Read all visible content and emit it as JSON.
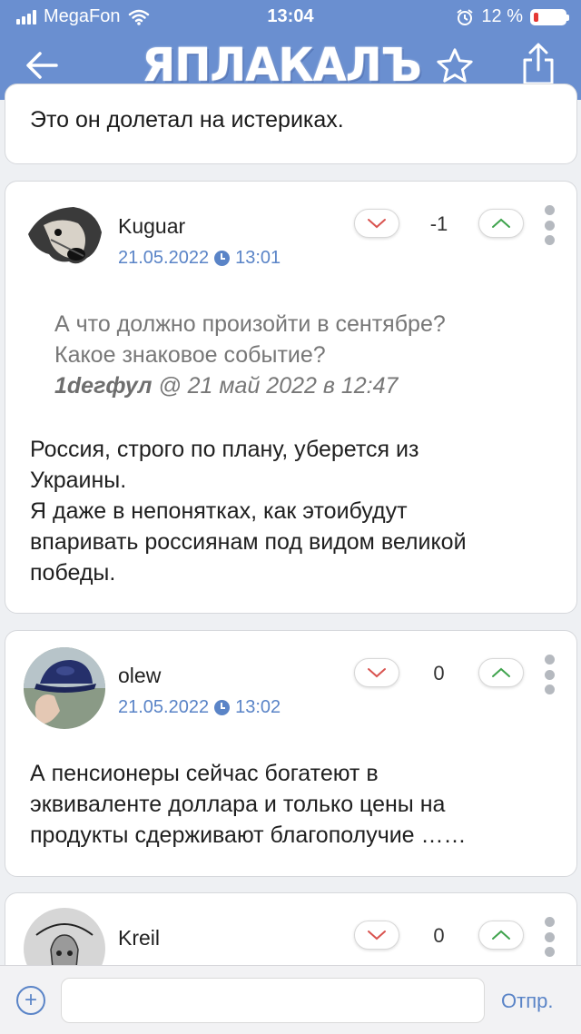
{
  "status_bar": {
    "carrier": "MegaFon",
    "time": "13:04",
    "battery": "12 %",
    "battery_level": 0.12
  },
  "nav": {
    "title": "ЯПЛАКАЛЪ",
    "back_icon": "arrow-left-icon",
    "favorite_icon": "star-icon",
    "share_icon": "share-icon"
  },
  "prev_comment": {
    "text": "Это он долетал на истериках."
  },
  "comments": [
    {
      "author": "Kuguar",
      "date": "21.05.2022",
      "time": "13:01",
      "score": "-1",
      "quote": {
        "line1": "А что должно произойти в сентябре?",
        "line2": "Какое знаковое событие?",
        "quote_author": "1dегфул",
        "quote_meta": "@ 21 май 2022 в 12:47"
      },
      "text_lines": [
        "Россия, строго по плану, уберется из",
        "Украины.",
        "Я даже в непонятках, как этоибудут",
        "впаривать россиянам под видом великой",
        "победы."
      ]
    },
    {
      "author": "olew",
      "date": "21.05.2022",
      "time": "13:02",
      "score": "0",
      "text_lines": [
        "А пенсионеры сейчас богатеют в",
        "эквиваленте доллара и только цены на",
        "продукты сдерживают благополучие ……"
      ]
    },
    {
      "author": "Kreil",
      "score": "0"
    }
  ],
  "input": {
    "placeholder": "",
    "value": "",
    "send_label": "Отпр."
  },
  "colors": {
    "header": "#6a8fd0",
    "link": "#5a84c7",
    "vote_down": "#d9534f",
    "vote_up": "#3fa34d"
  }
}
